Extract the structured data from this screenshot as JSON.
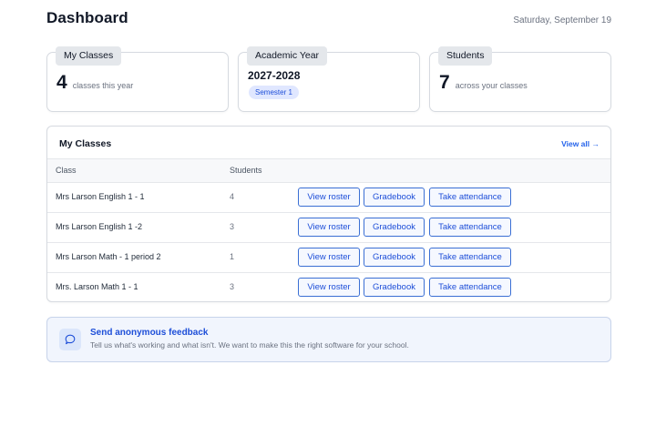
{
  "header": {
    "title": "Dashboard",
    "date": "Saturday, September 19"
  },
  "stats": {
    "classes": {
      "label": "My Classes",
      "value": "4",
      "sub": "classes this year"
    },
    "year": {
      "label": "Academic Year",
      "value": "2027-2028",
      "badge": "Semester 1"
    },
    "students": {
      "label": "Students",
      "value": "7",
      "sub": "across your classes"
    }
  },
  "classes_table": {
    "title": "My Classes",
    "view_all": "View all →",
    "columns": [
      "Class",
      "Students"
    ],
    "rows": [
      {
        "class": "Mrs Larson English 1 - 1",
        "students": "4"
      },
      {
        "class": "Mrs Larson English 1 -2",
        "students": "3"
      },
      {
        "class": "Mrs Larson Math - 1 period 2",
        "students": "1"
      },
      {
        "class": "Mrs. Larson Math 1 - 1",
        "students": "3"
      }
    ],
    "actions": {
      "roster": "View roster",
      "gradebook": "Gradebook",
      "attendance": "Take attendance"
    }
  },
  "feedback": {
    "title": "Send anonymous feedback",
    "subtitle": "Tell us what's working and what isn't. We want to make this the right software for your school.",
    "icon": "chat-bubble-icon"
  },
  "colors": {
    "accent": "#2563eb",
    "tab_bg": "#e4e7eb",
    "feedback_bg": "#f1f5fd"
  }
}
